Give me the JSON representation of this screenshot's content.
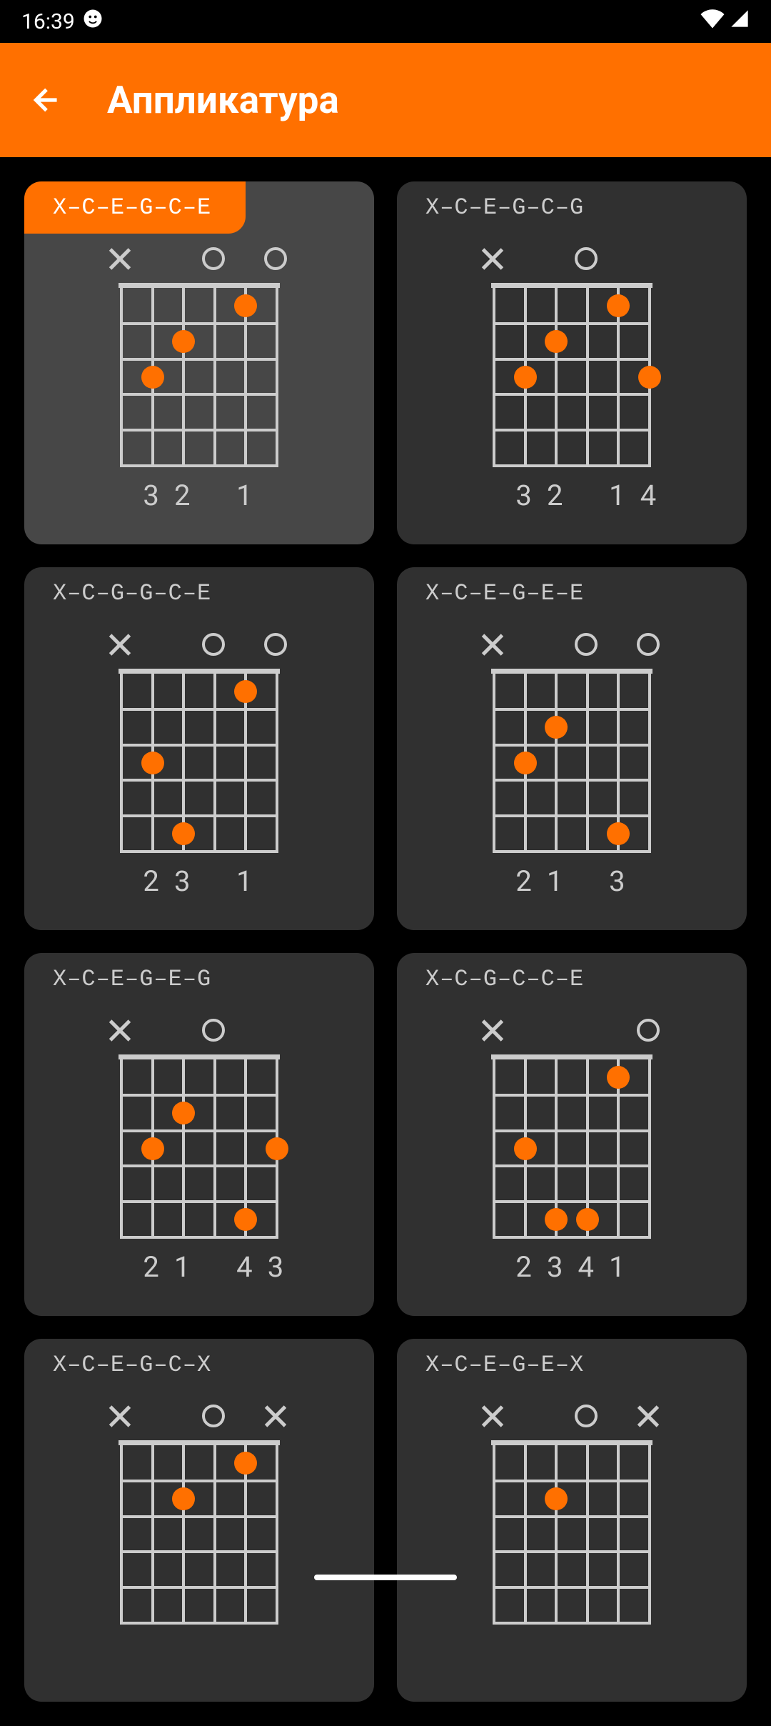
{
  "status": {
    "time": "16:39"
  },
  "header": {
    "title": "Аппликатура"
  },
  "chords": [
    {
      "label": "X–C–E–G–C–E",
      "selected": true,
      "strings": [
        "x",
        null,
        null,
        "o",
        null,
        "o"
      ],
      "dots": [
        {
          "string": 1,
          "fret": 3
        },
        {
          "string": 2,
          "fret": 2
        },
        {
          "string": 4,
          "fret": 1
        }
      ],
      "fingers": [
        "",
        "3",
        "2",
        "",
        "1",
        ""
      ]
    },
    {
      "label": "X–C–E–G–C–G",
      "selected": false,
      "strings": [
        "x",
        null,
        null,
        "o",
        null,
        null
      ],
      "dots": [
        {
          "string": 1,
          "fret": 3
        },
        {
          "string": 2,
          "fret": 2
        },
        {
          "string": 4,
          "fret": 1
        },
        {
          "string": 5,
          "fret": 3
        }
      ],
      "fingers": [
        "",
        "3",
        "2",
        "",
        "1",
        "4"
      ]
    },
    {
      "label": "X–C–G–G–C–E",
      "selected": false,
      "strings": [
        "x",
        null,
        null,
        "o",
        null,
        "o"
      ],
      "dots": [
        {
          "string": 1,
          "fret": 3
        },
        {
          "string": 2,
          "fret": 5
        },
        {
          "string": 4,
          "fret": 1
        }
      ],
      "fingers": [
        "",
        "2",
        "3",
        "",
        "1",
        ""
      ]
    },
    {
      "label": "X–C–E–G–E–E",
      "selected": false,
      "strings": [
        "x",
        null,
        null,
        "o",
        null,
        "o"
      ],
      "dots": [
        {
          "string": 1,
          "fret": 3
        },
        {
          "string": 2,
          "fret": 2
        },
        {
          "string": 4,
          "fret": 5
        }
      ],
      "fingers": [
        "",
        "2",
        "1",
        "",
        "3",
        ""
      ]
    },
    {
      "label": "X–C–E–G–E–G",
      "selected": false,
      "strings": [
        "x",
        null,
        null,
        "o",
        null,
        null
      ],
      "dots": [
        {
          "string": 1,
          "fret": 3
        },
        {
          "string": 2,
          "fret": 2
        },
        {
          "string": 4,
          "fret": 5
        },
        {
          "string": 5,
          "fret": 3
        }
      ],
      "fingers": [
        "",
        "2",
        "1",
        "",
        "4",
        "3"
      ]
    },
    {
      "label": "X–C–G–C–C–E",
      "selected": false,
      "strings": [
        "x",
        null,
        null,
        null,
        null,
        "o"
      ],
      "dots": [
        {
          "string": 1,
          "fret": 3
        },
        {
          "string": 2,
          "fret": 5
        },
        {
          "string": 3,
          "fret": 5
        },
        {
          "string": 4,
          "fret": 1
        }
      ],
      "fingers": [
        "",
        "2",
        "3",
        "4",
        "1",
        ""
      ]
    },
    {
      "label": "X–C–E–G–C–X",
      "selected": false,
      "strings": [
        "x",
        null,
        null,
        "o",
        null,
        "x"
      ],
      "dots": [
        {
          "string": 2,
          "fret": 2
        },
        {
          "string": 4,
          "fret": 1
        }
      ],
      "fingers": []
    },
    {
      "label": "X–C–E–G–E–X",
      "selected": false,
      "strings": [
        "x",
        null,
        null,
        "o",
        null,
        "x"
      ],
      "dots": [
        {
          "string": 2,
          "fret": 2
        }
      ],
      "fingers": []
    }
  ]
}
